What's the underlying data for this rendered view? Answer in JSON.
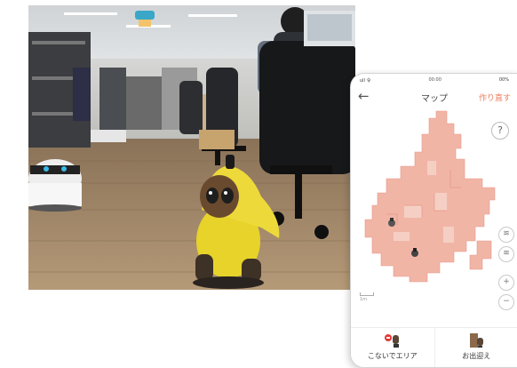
{
  "phone": {
    "status_left": "ull 令",
    "status_center": "00:00",
    "status_right": "00%",
    "back_icon": "arrow-left-icon",
    "title": "マップ",
    "action_label": "作り直す",
    "help_label": "?",
    "side_tools": [
      {
        "icon": "wifi-icon",
        "glyph": "≋"
      },
      {
        "icon": "wifi-outline-icon",
        "glyph": "≋"
      },
      {
        "icon": "zoom-in-icon",
        "glyph": "+"
      },
      {
        "icon": "zoom-out-icon",
        "glyph": "−"
      }
    ],
    "scale_label": "1m",
    "bottom_nav": [
      {
        "label": "こないでエリア",
        "icon": "no-entry-robot-icon"
      },
      {
        "label": "お出迎え",
        "icon": "door-robot-icon"
      }
    ]
  },
  "colors": {
    "accent": "#ef7d5d",
    "map_fill": "#f1b5a6"
  }
}
